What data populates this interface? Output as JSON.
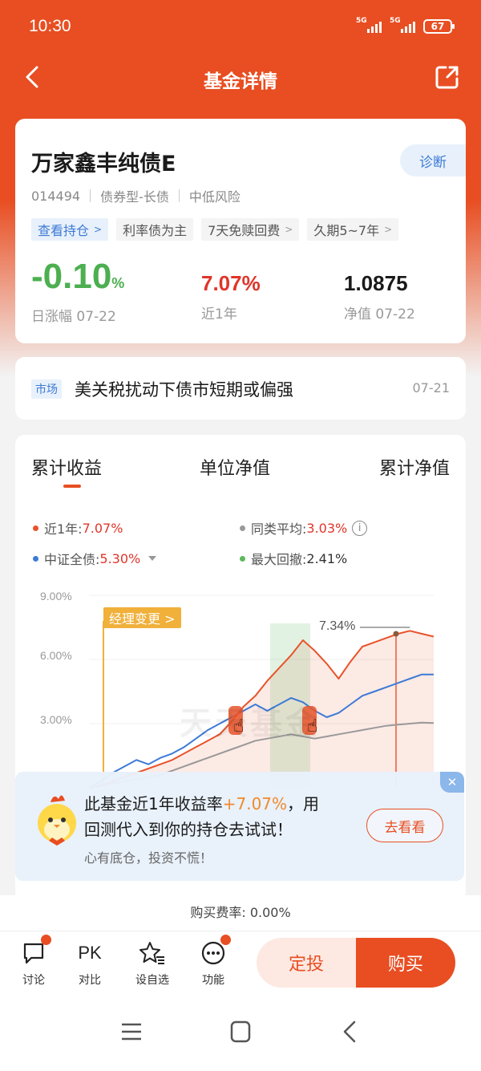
{
  "status_bar": {
    "time": "10:30",
    "signal1": "5G",
    "signal2": "5G",
    "battery": "67"
  },
  "nav": {
    "title": "基金详情"
  },
  "fund": {
    "name": "万家鑫丰纯债E",
    "code": "014494",
    "type": "债券型-长债",
    "risk": "中低风险",
    "diagnose_label": "诊断",
    "tags": [
      "查看持仓",
      "利率债为主",
      "7天免赎回费",
      "久期5~7年"
    ],
    "daily_change": "-0.10",
    "daily_change_unit": "%",
    "daily_change_label": "日涨幅 07-22",
    "year_return": "7.07%",
    "year_return_label": "近1年",
    "nav_value": "1.0875",
    "nav_label": "净值 07-22"
  },
  "news": {
    "tag": "市场",
    "text": "美关税扰动下债市短期或偏强",
    "date": "07-21"
  },
  "chart_tabs": [
    "累计收益",
    "单位净值",
    "累计净值"
  ],
  "legend": {
    "fund": {
      "label": "近1年:",
      "value": "7.07%",
      "color": "#e8532a"
    },
    "peer": {
      "label": "同类平均:",
      "value": "3.03%",
      "color": "#999999"
    },
    "bench": {
      "label": "中证全债:",
      "value": "5.30%",
      "color": "#3d7ad6"
    },
    "drawdown": {
      "label": "最大回撤:",
      "value": "2.41%",
      "color": "#5cb85c"
    }
  },
  "chart_data": {
    "type": "line",
    "y_ticks": [
      "9.00%",
      "6.00%",
      "3.00%"
    ],
    "ylim": [
      0,
      9
    ],
    "manager_change_label": "经理变更 >",
    "peak_label": "7.34%",
    "watermark": "天天基金",
    "series": [
      {
        "name": "近1年",
        "color": "#e8532a",
        "values": [
          0.0,
          0.1,
          0.3,
          0.5,
          0.7,
          0.9,
          1.1,
          1.3,
          1.6,
          1.9,
          2.2,
          2.5,
          3.1,
          3.8,
          4.3,
          5.0,
          5.6,
          6.2,
          6.9,
          6.4,
          5.8,
          5.1,
          5.9,
          6.6,
          6.8,
          7.0,
          7.2,
          7.34,
          7.2,
          7.07
        ]
      },
      {
        "name": "中证全债",
        "color": "#3d7ad6",
        "values": [
          0.0,
          0.3,
          0.7,
          1.0,
          1.3,
          1.1,
          1.4,
          1.6,
          1.9,
          2.3,
          2.7,
          3.0,
          3.3,
          3.6,
          3.9,
          3.6,
          3.9,
          4.2,
          4.0,
          3.6,
          3.3,
          3.5,
          3.9,
          4.3,
          4.5,
          4.7,
          4.9,
          5.1,
          5.3,
          5.3
        ]
      },
      {
        "name": "同类平均",
        "color": "#999999",
        "values": [
          0.0,
          0.1,
          0.2,
          0.3,
          0.4,
          0.5,
          0.6,
          0.8,
          1.0,
          1.2,
          1.4,
          1.6,
          1.8,
          2.0,
          2.2,
          2.3,
          2.4,
          2.5,
          2.4,
          2.3,
          2.4,
          2.5,
          2.6,
          2.7,
          2.8,
          2.9,
          2.95,
          3.0,
          3.05,
          3.03
        ]
      }
    ]
  },
  "promo": {
    "line1_a": "此基金近1年收益率",
    "line1_hl": "+7.07%",
    "line1_b": "，用",
    "line2": "回测代入到你的持仓去试试！",
    "sub": "心有底仓，投资不慌！",
    "button": "去看看",
    "close": "✕"
  },
  "fee": "购买费率: 0.00%",
  "bottom": {
    "discuss": "讨论",
    "pk_icon": "PK",
    "compare": "对比",
    "watch": "设自选",
    "functions": "功能",
    "dingtou": "定投",
    "buy": "购买"
  }
}
